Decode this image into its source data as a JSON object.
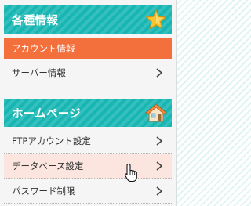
{
  "sections": [
    {
      "title": "各種情報",
      "icon": "star-icon",
      "items": [
        {
          "label": "アカウント情報",
          "state": "active"
        },
        {
          "label": "サーバー情報",
          "state": "normal"
        }
      ]
    },
    {
      "title": "ホームページ",
      "icon": "house-icon",
      "items": [
        {
          "label": "FTPアカウント設定",
          "state": "normal"
        },
        {
          "label": "データベース設定",
          "state": "hover"
        },
        {
          "label": "パスワード制限",
          "state": "normal"
        }
      ]
    }
  ],
  "colors": {
    "header": "#17b6b3",
    "active": "#f36f3c",
    "hover": "#fbe5de"
  },
  "cursor": "hand-pointer-icon"
}
